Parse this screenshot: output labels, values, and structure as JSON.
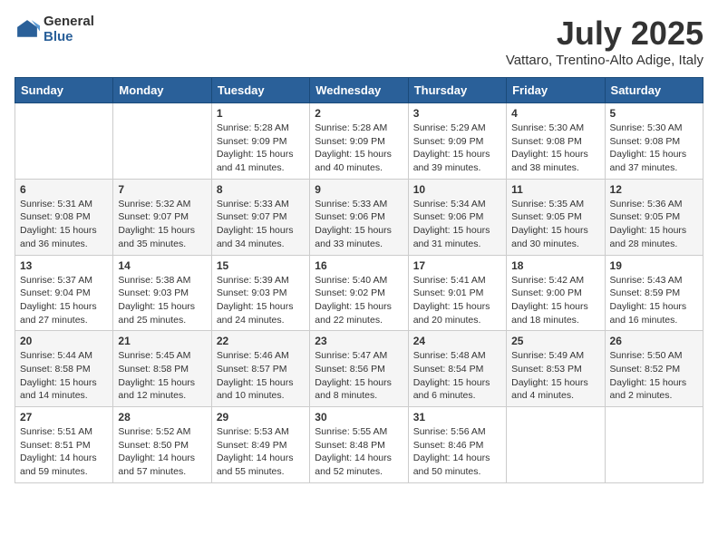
{
  "logo": {
    "general": "General",
    "blue": "Blue"
  },
  "header": {
    "month": "July 2025",
    "location": "Vattaro, Trentino-Alto Adige, Italy"
  },
  "weekdays": [
    "Sunday",
    "Monday",
    "Tuesday",
    "Wednesday",
    "Thursday",
    "Friday",
    "Saturday"
  ],
  "weeks": [
    [
      {
        "day": "",
        "sunrise": "",
        "sunset": "",
        "daylight": ""
      },
      {
        "day": "",
        "sunrise": "",
        "sunset": "",
        "daylight": ""
      },
      {
        "day": "1",
        "sunrise": "Sunrise: 5:28 AM",
        "sunset": "Sunset: 9:09 PM",
        "daylight": "Daylight: 15 hours and 41 minutes."
      },
      {
        "day": "2",
        "sunrise": "Sunrise: 5:28 AM",
        "sunset": "Sunset: 9:09 PM",
        "daylight": "Daylight: 15 hours and 40 minutes."
      },
      {
        "day": "3",
        "sunrise": "Sunrise: 5:29 AM",
        "sunset": "Sunset: 9:09 PM",
        "daylight": "Daylight: 15 hours and 39 minutes."
      },
      {
        "day": "4",
        "sunrise": "Sunrise: 5:30 AM",
        "sunset": "Sunset: 9:08 PM",
        "daylight": "Daylight: 15 hours and 38 minutes."
      },
      {
        "day": "5",
        "sunrise": "Sunrise: 5:30 AM",
        "sunset": "Sunset: 9:08 PM",
        "daylight": "Daylight: 15 hours and 37 minutes."
      }
    ],
    [
      {
        "day": "6",
        "sunrise": "Sunrise: 5:31 AM",
        "sunset": "Sunset: 9:08 PM",
        "daylight": "Daylight: 15 hours and 36 minutes."
      },
      {
        "day": "7",
        "sunrise": "Sunrise: 5:32 AM",
        "sunset": "Sunset: 9:07 PM",
        "daylight": "Daylight: 15 hours and 35 minutes."
      },
      {
        "day": "8",
        "sunrise": "Sunrise: 5:33 AM",
        "sunset": "Sunset: 9:07 PM",
        "daylight": "Daylight: 15 hours and 34 minutes."
      },
      {
        "day": "9",
        "sunrise": "Sunrise: 5:33 AM",
        "sunset": "Sunset: 9:06 PM",
        "daylight": "Daylight: 15 hours and 33 minutes."
      },
      {
        "day": "10",
        "sunrise": "Sunrise: 5:34 AM",
        "sunset": "Sunset: 9:06 PM",
        "daylight": "Daylight: 15 hours and 31 minutes."
      },
      {
        "day": "11",
        "sunrise": "Sunrise: 5:35 AM",
        "sunset": "Sunset: 9:05 PM",
        "daylight": "Daylight: 15 hours and 30 minutes."
      },
      {
        "day": "12",
        "sunrise": "Sunrise: 5:36 AM",
        "sunset": "Sunset: 9:05 PM",
        "daylight": "Daylight: 15 hours and 28 minutes."
      }
    ],
    [
      {
        "day": "13",
        "sunrise": "Sunrise: 5:37 AM",
        "sunset": "Sunset: 9:04 PM",
        "daylight": "Daylight: 15 hours and 27 minutes."
      },
      {
        "day": "14",
        "sunrise": "Sunrise: 5:38 AM",
        "sunset": "Sunset: 9:03 PM",
        "daylight": "Daylight: 15 hours and 25 minutes."
      },
      {
        "day": "15",
        "sunrise": "Sunrise: 5:39 AM",
        "sunset": "Sunset: 9:03 PM",
        "daylight": "Daylight: 15 hours and 24 minutes."
      },
      {
        "day": "16",
        "sunrise": "Sunrise: 5:40 AM",
        "sunset": "Sunset: 9:02 PM",
        "daylight": "Daylight: 15 hours and 22 minutes."
      },
      {
        "day": "17",
        "sunrise": "Sunrise: 5:41 AM",
        "sunset": "Sunset: 9:01 PM",
        "daylight": "Daylight: 15 hours and 20 minutes."
      },
      {
        "day": "18",
        "sunrise": "Sunrise: 5:42 AM",
        "sunset": "Sunset: 9:00 PM",
        "daylight": "Daylight: 15 hours and 18 minutes."
      },
      {
        "day": "19",
        "sunrise": "Sunrise: 5:43 AM",
        "sunset": "Sunset: 8:59 PM",
        "daylight": "Daylight: 15 hours and 16 minutes."
      }
    ],
    [
      {
        "day": "20",
        "sunrise": "Sunrise: 5:44 AM",
        "sunset": "Sunset: 8:58 PM",
        "daylight": "Daylight: 15 hours and 14 minutes."
      },
      {
        "day": "21",
        "sunrise": "Sunrise: 5:45 AM",
        "sunset": "Sunset: 8:58 PM",
        "daylight": "Daylight: 15 hours and 12 minutes."
      },
      {
        "day": "22",
        "sunrise": "Sunrise: 5:46 AM",
        "sunset": "Sunset: 8:57 PM",
        "daylight": "Daylight: 15 hours and 10 minutes."
      },
      {
        "day": "23",
        "sunrise": "Sunrise: 5:47 AM",
        "sunset": "Sunset: 8:56 PM",
        "daylight": "Daylight: 15 hours and 8 minutes."
      },
      {
        "day": "24",
        "sunrise": "Sunrise: 5:48 AM",
        "sunset": "Sunset: 8:54 PM",
        "daylight": "Daylight: 15 hours and 6 minutes."
      },
      {
        "day": "25",
        "sunrise": "Sunrise: 5:49 AM",
        "sunset": "Sunset: 8:53 PM",
        "daylight": "Daylight: 15 hours and 4 minutes."
      },
      {
        "day": "26",
        "sunrise": "Sunrise: 5:50 AM",
        "sunset": "Sunset: 8:52 PM",
        "daylight": "Daylight: 15 hours and 2 minutes."
      }
    ],
    [
      {
        "day": "27",
        "sunrise": "Sunrise: 5:51 AM",
        "sunset": "Sunset: 8:51 PM",
        "daylight": "Daylight: 14 hours and 59 minutes."
      },
      {
        "day": "28",
        "sunrise": "Sunrise: 5:52 AM",
        "sunset": "Sunset: 8:50 PM",
        "daylight": "Daylight: 14 hours and 57 minutes."
      },
      {
        "day": "29",
        "sunrise": "Sunrise: 5:53 AM",
        "sunset": "Sunset: 8:49 PM",
        "daylight": "Daylight: 14 hours and 55 minutes."
      },
      {
        "day": "30",
        "sunrise": "Sunrise: 5:55 AM",
        "sunset": "Sunset: 8:48 PM",
        "daylight": "Daylight: 14 hours and 52 minutes."
      },
      {
        "day": "31",
        "sunrise": "Sunrise: 5:56 AM",
        "sunset": "Sunset: 8:46 PM",
        "daylight": "Daylight: 14 hours and 50 minutes."
      },
      {
        "day": "",
        "sunrise": "",
        "sunset": "",
        "daylight": ""
      },
      {
        "day": "",
        "sunrise": "",
        "sunset": "",
        "daylight": ""
      }
    ]
  ]
}
